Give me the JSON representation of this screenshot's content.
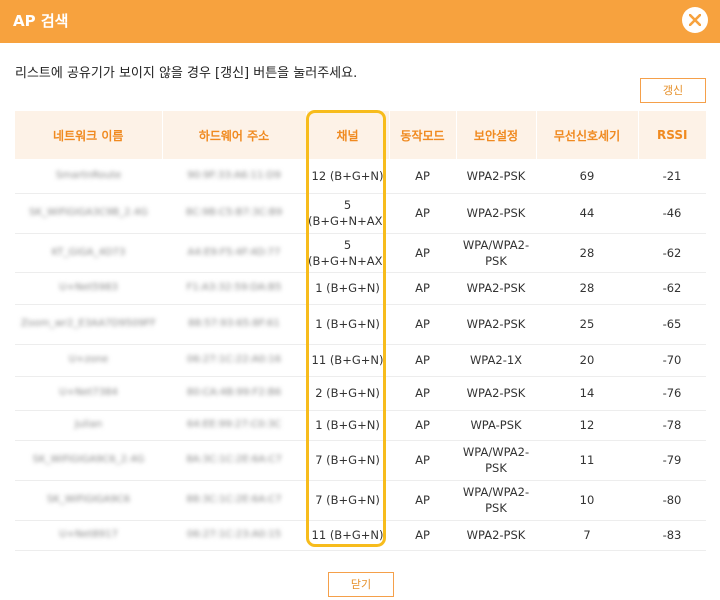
{
  "header": {
    "title": "AP 검색"
  },
  "instruction": "리스트에 공유기가 보이지 않을 경우 [갱신] 버튼을 눌러주세요.",
  "buttons": {
    "refresh": "갱신",
    "close": "닫기"
  },
  "table": {
    "columns": [
      "네트워크 이름",
      "하드웨어 주소",
      "채널",
      "동작모드",
      "보안설정",
      "무선신호세기",
      "RSSI"
    ],
    "rows": [
      {
        "ssid": "SmartnRoute",
        "mac": "90:9F:33:A6:11:D9",
        "channel": "12 (B+G+N)",
        "mode": "AP",
        "security": "WPA2-PSK",
        "signal": "69",
        "rssi": "-21"
      },
      {
        "ssid": "SK_WiFiGIGA3C9B_2.4G",
        "mac": "8C:9B:C5:B7:3C:B9",
        "channel": "5 (B+G+N+AX)",
        "mode": "AP",
        "security": "WPA2-PSK",
        "signal": "44",
        "rssi": "-46"
      },
      {
        "ssid": "KT_GiGA_4D73",
        "mac": "A4:E9:F5:4F:4D:77",
        "channel": "5 (B+G+N+AX)",
        "mode": "AP",
        "security": "WPA/WPA2-PSK",
        "signal": "28",
        "rssi": "-62"
      },
      {
        "ssid": "U+Net5983",
        "mac": "F1:A3:32:59:DA:B5",
        "channel": "1 (B+G+N)",
        "mode": "AP",
        "security": "WPA2-PSK",
        "signal": "28",
        "rssi": "-62"
      },
      {
        "ssid": "Zoom_wr2_E3AA7D9509FF",
        "mac": "88:57:93:65:8F:61",
        "channel": "1 (B+G+N)",
        "mode": "AP",
        "security": "WPA2-PSK",
        "signal": "25",
        "rssi": "-65"
      },
      {
        "ssid": "U+zone",
        "mac": "06:27:1C:22:A0:16",
        "channel": "11 (B+G+N)",
        "mode": "AP",
        "security": "WPA2-1X",
        "signal": "20",
        "rssi": "-70"
      },
      {
        "ssid": "U+Net7384",
        "mac": "80:CA:4B:99:F2:B6",
        "channel": "2 (B+G+N)",
        "mode": "AP",
        "security": "WPA2-PSK",
        "signal": "14",
        "rssi": "-76"
      },
      {
        "ssid": "Julian",
        "mac": "64:EE:99:27:C0:3C",
        "channel": "1 (B+G+N)",
        "mode": "AP",
        "security": "WPA-PSK",
        "signal": "12",
        "rssi": "-78"
      },
      {
        "ssid": "SK_WiFiGIGA9C6_2.4G",
        "mac": "8A:3C:1C:2E:6A:C7",
        "channel": "7 (B+G+N)",
        "mode": "AP",
        "security": "WPA/WPA2-PSK",
        "signal": "11",
        "rssi": "-79"
      },
      {
        "ssid": "SK_WiFiGIGA9C6",
        "mac": "88:3C:1C:2E:6A:C7",
        "channel": "7 (B+G+N)",
        "mode": "AP",
        "security": "WPA/WPA2-PSK",
        "signal": "10",
        "rssi": "-80"
      },
      {
        "ssid": "U+Net8917",
        "mac": "06:27:1C:23:A0:15",
        "channel": "11 (B+G+N)",
        "mode": "AP",
        "security": "WPA2-PSK",
        "signal": "7",
        "rssi": "-83"
      }
    ]
  },
  "colors": {
    "accent": "#f7a23e",
    "highlight": "#f7bc1c",
    "header_bg": "#fdf2e7",
    "header_text": "#f08a20"
  }
}
